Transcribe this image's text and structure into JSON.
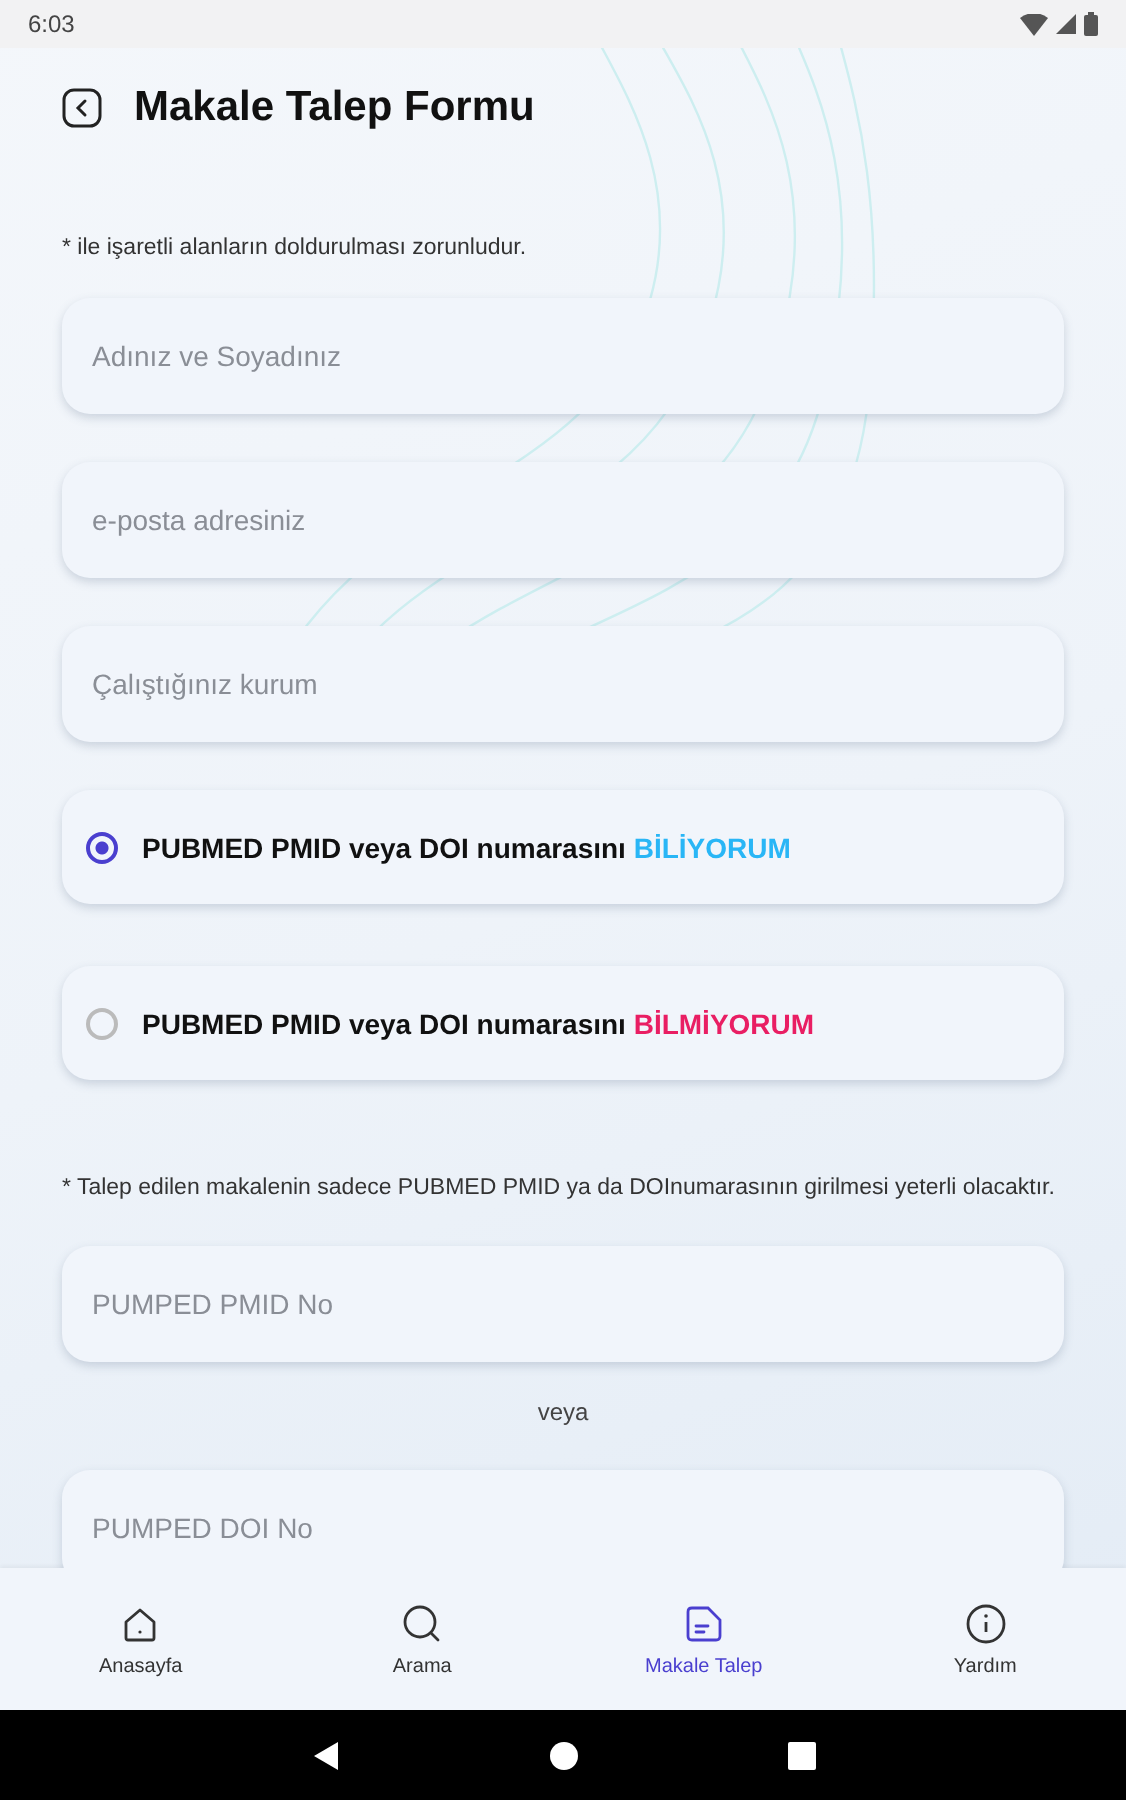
{
  "status_bar": {
    "time": "6:03"
  },
  "header": {
    "title": "Makale Talep Formu"
  },
  "required_note": "* ile işaretli alanların doldurulması zorunludur.",
  "fields": [
    {
      "placeholder": "Adınız ve Soyadınız"
    },
    {
      "placeholder": "e-posta adresiniz"
    },
    {
      "placeholder": "Çalıştığınız kurum"
    }
  ],
  "options": [
    {
      "label": "PUBMED PMID veya DOI numarasını",
      "emphasis": "BİLİYORUM",
      "color": "#29b6f6",
      "selected": true
    },
    {
      "label": "PUBMED PMID veya DOI numarasını",
      "emphasis": "BİLMİYORUM",
      "color": "#e91e63",
      "selected": false
    }
  ],
  "id_note": "* Talep edilen makalenin sadece PUBMED PMID ya da DOInumarasının girilmesi yeterli olacaktır.",
  "id_fields": [
    {
      "placeholder": "PUMPED PMID No"
    },
    {
      "placeholder": "PUMPED DOI No"
    }
  ],
  "separator": "veya",
  "bottom_nav": [
    {
      "label": "Anasayfa",
      "kind": "home",
      "selected": false
    },
    {
      "label": "Arama",
      "kind": "search",
      "selected": false
    },
    {
      "label": "Makale Talep",
      "kind": "document",
      "selected": true
    },
    {
      "label": "Yardım",
      "kind": "info",
      "selected": false
    }
  ]
}
